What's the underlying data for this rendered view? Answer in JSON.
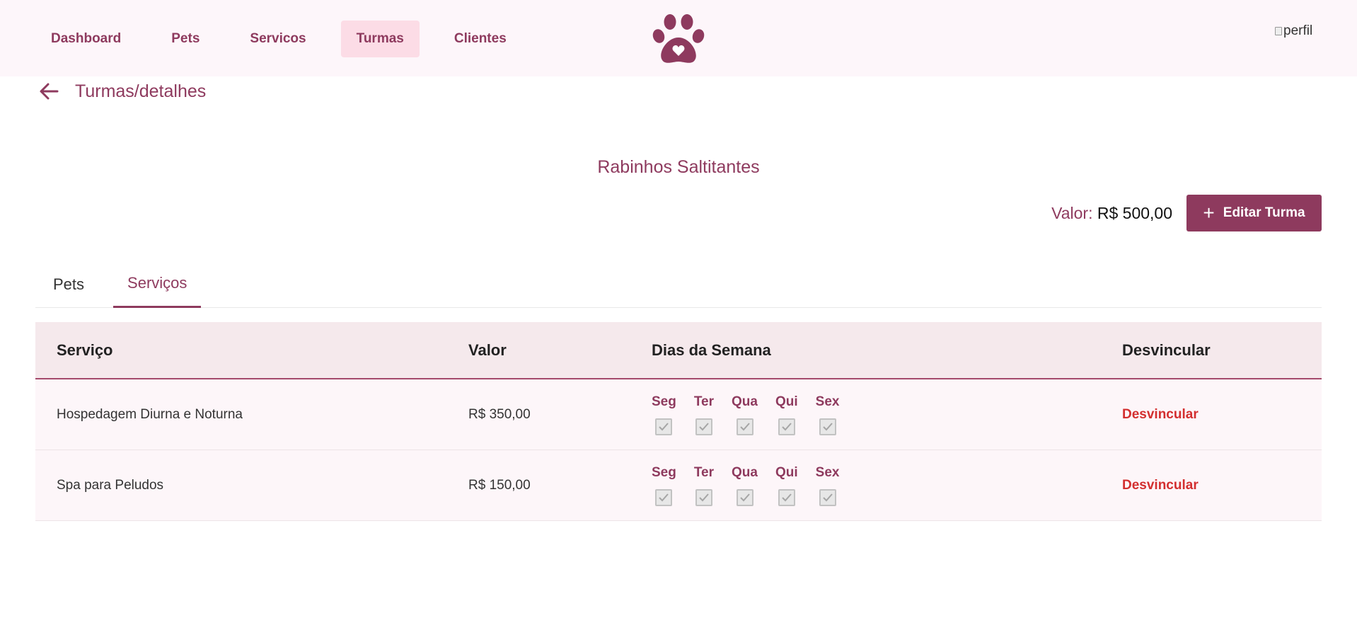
{
  "nav": {
    "items": [
      {
        "label": "Dashboard"
      },
      {
        "label": "Pets"
      },
      {
        "label": "Servicos"
      },
      {
        "label": "Turmas",
        "active": true
      },
      {
        "label": "Clientes"
      }
    ],
    "logo_icon": "paw-heart-icon",
    "avatar_alt": "perfil"
  },
  "breadcrumb": {
    "back_icon": "arrow-left-icon",
    "title": "Turmas/detalhes"
  },
  "turma": {
    "name": "Rabinhos Saltitantes",
    "valor_label": "Valor:",
    "valor_amount": "R$ 500,00",
    "edit_button": "Editar Turma"
  },
  "tabs": [
    {
      "label": "Pets"
    },
    {
      "label": "Serviços",
      "active": true
    }
  ],
  "table": {
    "headers": {
      "servico": "Serviço",
      "valor": "Valor",
      "dias": "Dias da Semana",
      "desvincular": "Desvincular"
    },
    "rows": [
      {
        "servico": "Hospedagem Diurna e Noturna",
        "valor": "R$ 350,00",
        "dias": [
          "Seg",
          "Ter",
          "Qua",
          "Qui",
          "Sex"
        ],
        "checked": [
          true,
          true,
          true,
          true,
          true
        ],
        "action": "Desvincular"
      },
      {
        "servico": "Spa para Peludos",
        "valor": "R$ 150,00",
        "dias": [
          "Seg",
          "Ter",
          "Qua",
          "Qui",
          "Sex"
        ],
        "checked": [
          true,
          true,
          true,
          true,
          true
        ],
        "action": "Desvincular"
      }
    ]
  },
  "colors": {
    "primary": "#8e3a5e",
    "nav_active_bg": "#fcdce6",
    "danger": "#d32f2f",
    "header_bg": "#f5e9ec"
  }
}
